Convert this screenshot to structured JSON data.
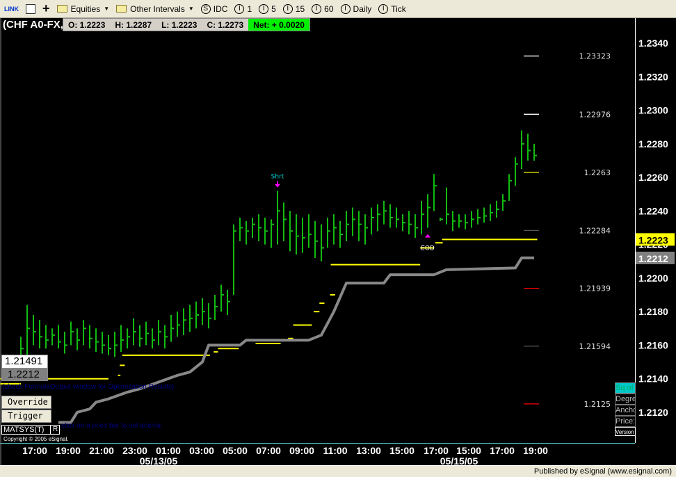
{
  "toolbar": {
    "link_label": "LINK",
    "items": [
      {
        "type": "folder",
        "label": "Equities"
      },
      {
        "type": "folder",
        "label": "Other Intervals"
      },
      {
        "type": "circle",
        "glyph": "S",
        "label": "IDC"
      },
      {
        "type": "circle",
        "glyph": "I",
        "label": "1"
      },
      {
        "type": "circle",
        "glyph": "I",
        "label": "5"
      },
      {
        "type": "circle",
        "glyph": "I",
        "label": "15"
      },
      {
        "type": "circle",
        "glyph": "I",
        "label": "60"
      },
      {
        "type": "circle",
        "glyph": "I",
        "label": "Daily"
      },
      {
        "type": "circle",
        "glyph": "I",
        "label": "Tick"
      }
    ]
  },
  "symbol": "(CHF A0-FX,",
  "ohlc": {
    "open": "O:  1.2223",
    "high": "H:  1.2287",
    "low": "L:  1.2223",
    "close": "C:  1.2273",
    "net": "Net: + 0.0020"
  },
  "colors": {
    "bars": "#11bb11",
    "yellow": "#ffff00",
    "gray_line": "#888888",
    "accent_net": "#00f000"
  },
  "price_axis": {
    "ticks": [
      "1.2340",
      "1.2320",
      "1.2300",
      "1.2280",
      "1.2260",
      "1.2240",
      "1.2220",
      "1.2200",
      "1.2180",
      "1.2160",
      "1.2140",
      "1.2120"
    ],
    "tag_yellow": "1.2223",
    "tag_gray": "1.2212"
  },
  "time_axis": {
    "labels": [
      "17:00",
      "19:00",
      "21:00",
      "23:00",
      "01:00",
      "03:00",
      "05:00",
      "07:00",
      "09:00",
      "11:00",
      "13:00",
      "15:00",
      "17:00",
      "15:00",
      "17:00",
      "19:00"
    ],
    "dates": [
      "05/13/05",
      "05/15/05"
    ]
  },
  "levels": [
    {
      "label": "1.23323",
      "price": 1.23323,
      "color": "#ffffff"
    },
    {
      "label": "1.22976",
      "price": 1.22976,
      "color": "#ffffff"
    },
    {
      "label": "1.2263",
      "price": 1.2263,
      "color": "#ffff00"
    },
    {
      "label": "1.22284",
      "price": 1.22284,
      "color": "#555555"
    },
    {
      "label": "1.21939",
      "price": 1.21939,
      "color": "#ff0000"
    },
    {
      "label": "1.21594",
      "price": 1.21594,
      "color": "#555555"
    },
    {
      "label": "1.2125",
      "price": 1.2125,
      "color": "#ff0000"
    }
  ],
  "chart_data": {
    "type": "ohlc-bar",
    "ylim": [
      1.211,
      1.235
    ],
    "bars_hlc": [
      [
        1.2165,
        1.2145,
        1.2158
      ],
      [
        1.2184,
        1.215,
        1.217
      ],
      [
        1.2178,
        1.216,
        1.2168
      ],
      [
        1.2175,
        1.2158,
        1.2165
      ],
      [
        1.2172,
        1.2158,
        1.2163
      ],
      [
        1.217,
        1.216,
        1.2166
      ],
      [
        1.2172,
        1.2158,
        1.2162
      ],
      [
        1.2168,
        1.2155,
        1.216
      ],
      [
        1.2174,
        1.216,
        1.2168
      ],
      [
        1.217,
        1.2157,
        1.2163
      ],
      [
        1.2175,
        1.216,
        1.217
      ],
      [
        1.2172,
        1.2158,
        1.2164
      ],
      [
        1.217,
        1.2156,
        1.2162
      ],
      [
        1.2168,
        1.2155,
        1.216
      ],
      [
        1.2166,
        1.2154,
        1.2158
      ],
      [
        1.2168,
        1.2153,
        1.216
      ],
      [
        1.2172,
        1.2156,
        1.2163
      ],
      [
        1.217,
        1.2158,
        1.2165
      ],
      [
        1.2176,
        1.216,
        1.2168
      ],
      [
        1.2172,
        1.2159,
        1.2164
      ],
      [
        1.2174,
        1.216,
        1.2167
      ],
      [
        1.217,
        1.2158,
        1.2163
      ],
      [
        1.2175,
        1.216,
        1.2168
      ],
      [
        1.2172,
        1.2158,
        1.2165
      ],
      [
        1.2178,
        1.2162,
        1.217
      ],
      [
        1.218,
        1.2165,
        1.2172
      ],
      [
        1.2182,
        1.2166,
        1.2175
      ],
      [
        1.2184,
        1.2168,
        1.2176
      ],
      [
        1.2186,
        1.217,
        1.2178
      ],
      [
        1.2188,
        1.2172,
        1.218
      ],
      [
        1.2185,
        1.217,
        1.2176
      ],
      [
        1.219,
        1.2175,
        1.2183
      ],
      [
        1.2196,
        1.218,
        1.219
      ],
      [
        1.2193,
        1.2178,
        1.2186
      ],
      [
        1.2232,
        1.219,
        1.2228
      ],
      [
        1.2236,
        1.2222,
        1.223
      ],
      [
        1.2234,
        1.222,
        1.2228
      ],
      [
        1.2236,
        1.2224,
        1.2232
      ],
      [
        1.2238,
        1.2222,
        1.223
      ],
      [
        1.2236,
        1.222,
        1.2228
      ],
      [
        1.2235,
        1.2218,
        1.2232
      ],
      [
        1.2252,
        1.222,
        1.224
      ],
      [
        1.2245,
        1.2222,
        1.2235
      ],
      [
        1.224,
        1.2216,
        1.2228
      ],
      [
        1.2238,
        1.2214,
        1.2225
      ],
      [
        1.2236,
        1.2215,
        1.2224
      ],
      [
        1.2238,
        1.2218,
        1.2226
      ],
      [
        1.2234,
        1.2212,
        1.2222
      ],
      [
        1.2232,
        1.221,
        1.2218
      ],
      [
        1.2236,
        1.2218,
        1.2228
      ],
      [
        1.2238,
        1.222,
        1.223
      ],
      [
        1.2234,
        1.2218,
        1.2226
      ],
      [
        1.224,
        1.2222,
        1.2232
      ],
      [
        1.2242,
        1.2225,
        1.2235
      ],
      [
        1.224,
        1.2222,
        1.2232
      ],
      [
        1.2238,
        1.222,
        1.223
      ],
      [
        1.2242,
        1.2226,
        1.2236
      ],
      [
        1.2244,
        1.2228,
        1.2238
      ],
      [
        1.2246,
        1.2232,
        1.224
      ],
      [
        1.2244,
        1.223,
        1.2236
      ],
      [
        1.2242,
        1.223,
        1.2235
      ],
      [
        1.2238,
        1.2228,
        1.2233
      ],
      [
        1.224,
        1.2226,
        1.2232
      ],
      [
        1.2238,
        1.2224,
        1.223
      ],
      [
        1.2246,
        1.2226,
        1.2238
      ],
      [
        1.225,
        1.223,
        1.2242
      ],
      [
        1.2262,
        1.224,
        1.2255
      ],
      [
        1.2236,
        1.2234,
        1.2235
      ],
      [
        1.2254,
        1.2232,
        1.2238
      ],
      [
        1.224,
        1.2228,
        1.2234
      ],
      [
        1.2238,
        1.223,
        1.2234
      ],
      [
        1.2238,
        1.2229,
        1.2233
      ],
      [
        1.224,
        1.223,
        1.2235
      ],
      [
        1.2241,
        1.2232,
        1.2236
      ],
      [
        1.2242,
        1.2233,
        1.2237
      ],
      [
        1.2244,
        1.2234,
        1.2239
      ],
      [
        1.2246,
        1.2236,
        1.2241
      ],
      [
        1.225,
        1.224,
        1.2246
      ],
      [
        1.2262,
        1.2246,
        1.2258
      ],
      [
        1.2272,
        1.2255,
        1.2268
      ],
      [
        1.2288,
        1.2265,
        1.228
      ],
      [
        1.2286,
        1.227,
        1.2276
      ],
      [
        1.228,
        1.227,
        1.2273
      ]
    ],
    "gray_line": [
      [
        6,
        1.2114
      ],
      [
        8,
        1.2114
      ],
      [
        9,
        1.212
      ],
      [
        11,
        1.2122
      ],
      [
        12,
        1.2126
      ],
      [
        14,
        1.2128
      ],
      [
        17,
        1.2132
      ],
      [
        19,
        1.2134
      ],
      [
        22,
        1.2138
      ],
      [
        25,
        1.2142
      ],
      [
        27,
        1.2144
      ],
      [
        29,
        1.215
      ],
      [
        30,
        1.216
      ],
      [
        35,
        1.216
      ],
      [
        36,
        1.2163
      ],
      [
        46,
        1.2163
      ],
      [
        48,
        1.2166
      ],
      [
        50,
        1.218
      ],
      [
        52,
        1.2197
      ],
      [
        58,
        1.2197
      ],
      [
        59,
        1.2202
      ],
      [
        66,
        1.2202
      ],
      [
        68,
        1.2205
      ],
      [
        79,
        1.2206
      ],
      [
        80,
        1.2212
      ],
      [
        82,
        1.2212
      ]
    ],
    "yellow_segments": [
      [
        -3.3,
        14,
        1.214
      ],
      [
        -3.3,
        0,
        1.2137
      ],
      [
        15.5,
        15.9,
        1.2142
      ],
      [
        15.8,
        16.6,
        1.2148
      ],
      [
        16.2,
        30.2,
        1.2154
      ],
      [
        30.8,
        31.5,
        1.2156
      ],
      [
        31.5,
        34.8,
        1.2158
      ],
      [
        37.5,
        41.5,
        1.2161
      ],
      [
        42.7,
        43.5,
        1.2164
      ],
      [
        43.5,
        46.5,
        1.2172
      ],
      [
        46.8,
        47.7,
        1.218
      ],
      [
        47.7,
        48.5,
        1.2185
      ],
      [
        49.4,
        50.2,
        1.219
      ],
      [
        49.5,
        63.8,
        1.2208
      ],
      [
        63.8,
        66,
        1.2218
      ],
      [
        66.2,
        67.4,
        1.2221
      ],
      [
        67.3,
        82.5,
        1.2223
      ]
    ],
    "signals": [
      {
        "label": "Shrt",
        "bar": 41,
        "price": 1.2256,
        "color": "#00cccc"
      },
      {
        "label": "EOD",
        "bar": 65,
        "price": 1.222,
        "color": "#ffffff"
      }
    ]
  },
  "overlay": {
    "value1": "1.21491",
    "value2": "1.2212",
    "optimization_note": "(check FormulaOutput window for Optimization Results)",
    "anchor_note": "click on a price bar to set anchor.",
    "override": "Override",
    "trigger": "Trigger",
    "matsys": "MATSYS(T)",
    "r": "R",
    "copyright": "Copyright © 2005 eSignal."
  },
  "right_panel": [
    "Sq of",
    "Degre",
    "Ancho",
    "Price:",
    "Version"
  ],
  "status": "Published by eSignal (www.esignal.com)"
}
